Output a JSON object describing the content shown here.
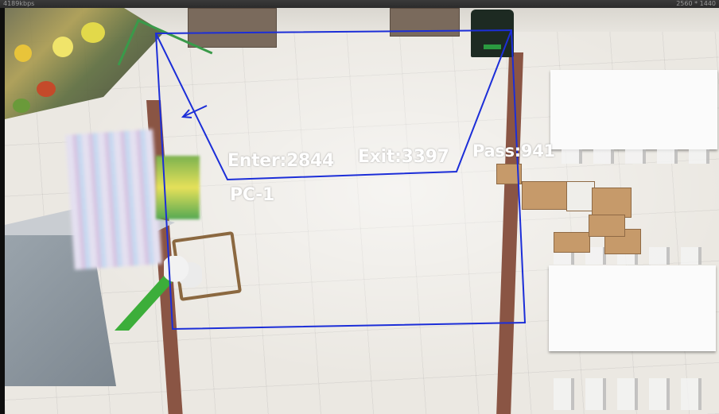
{
  "player": {
    "bitrate": "4189kbps",
    "resolution": "2560 * 1440"
  },
  "counter": {
    "enter_label": "Enter:2844",
    "exit_label": "Exit:3397",
    "pass_label": "Pass:941",
    "device_label": "PC-1"
  },
  "colors": {
    "region_outline": "#1c2ed8",
    "osd_text": "#ffffff"
  },
  "icons": {
    "direction_arrow": "direction-arrow-icon"
  }
}
